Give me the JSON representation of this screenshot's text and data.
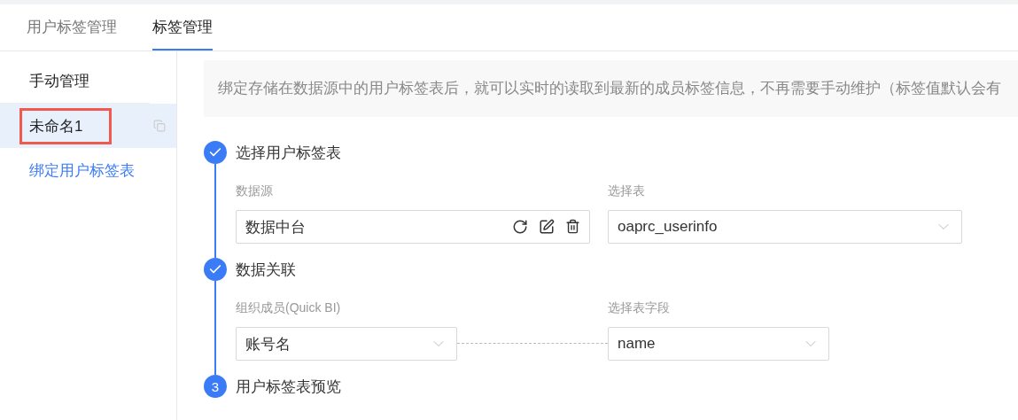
{
  "tabs": [
    {
      "label": "用户标签管理",
      "selected": false
    },
    {
      "label": "标签管理",
      "selected": true
    }
  ],
  "sidebar": {
    "items": [
      {
        "label": "手动管理",
        "kind": "heading",
        "selected": false
      },
      {
        "label": "未命名1",
        "kind": "item",
        "selected": true,
        "annotated": true
      },
      {
        "label": "绑定用户标签表",
        "kind": "link",
        "selected": false
      }
    ]
  },
  "notice": "绑定存储在数据源中的用户标签表后，就可以实时的读取到最新的成员标签信息，不再需要手动维护（标签值默认会有",
  "steps": [
    {
      "title": "选择用户标签表",
      "done": true,
      "kind": "source",
      "fields": [
        {
          "label": "数据源",
          "value": "数据中台"
        },
        {
          "label": "选择表",
          "value": "oaprc_userinfo"
        }
      ]
    },
    {
      "title": "数据关联",
      "done": true,
      "kind": "mapping",
      "fields": [
        {
          "label": "组织成员(Quick BI)",
          "value": "账号名"
        },
        {
          "label": "选择表字段",
          "value": "name"
        }
      ]
    },
    {
      "title": "用户标签表预览",
      "done": false,
      "number": "3",
      "kind": "preview"
    }
  ]
}
